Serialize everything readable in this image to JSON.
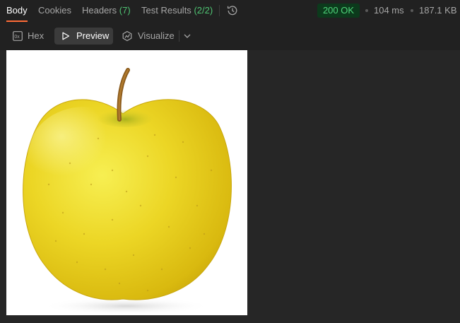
{
  "tabs": [
    {
      "label": "Body",
      "count": ""
    },
    {
      "label": "Cookies",
      "count": ""
    },
    {
      "label": "Headers",
      "count": "(7)"
    },
    {
      "label": "Test Results",
      "count": "(2/2)"
    }
  ],
  "response": {
    "status": "200 OK",
    "time": "104 ms",
    "size": "187.1 KB"
  },
  "view_modes": {
    "hex": "Hex",
    "preview": "Preview",
    "visualize": "Visualize"
  },
  "colors": {
    "accent": "#ff6c37",
    "status_green": "#4fd57b",
    "background": "#262626"
  },
  "icons": {
    "history": "history-icon",
    "hex": "hex-icon",
    "preview": "play-icon",
    "visualize": "visualize-icon",
    "dropdown": "chevron-down-icon"
  },
  "preview_image": {
    "subject": "yellow apple"
  }
}
